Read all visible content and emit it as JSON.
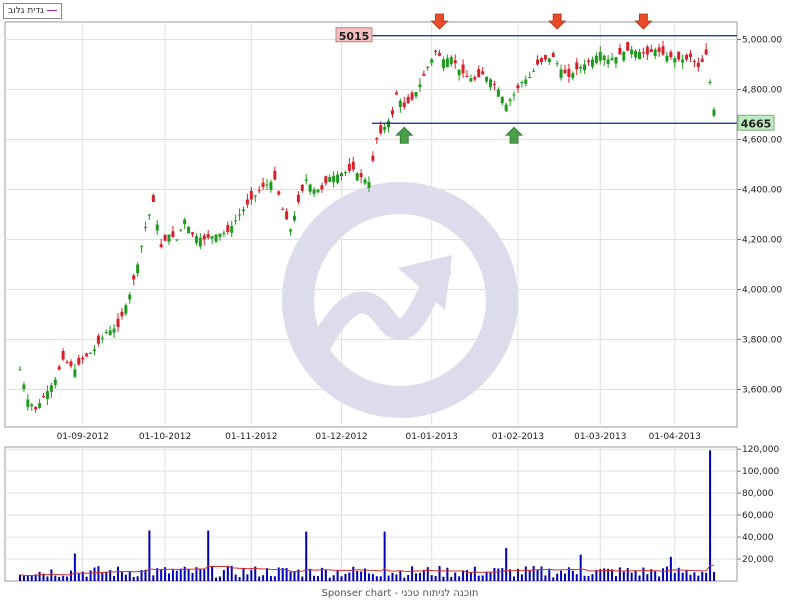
{
  "legend": {
    "label": "גדית גלוב"
  },
  "footer": {
    "text": "Sponser chart - תוכנה לניתוח טכני"
  },
  "colors": {
    "up": "#1f9a1f",
    "down": "#d8202a",
    "volume_bar": "#0000b8",
    "volume_ma": "#d03030",
    "level_line": "#0a2a8a",
    "resistance_label_bg": "#f4c0c0",
    "support_label_bg": "#bfeabf",
    "grid": "#e0e0e0",
    "arrow_down": "#e84a2a",
    "arrow_up": "#4aa04a",
    "watermark": "#dcdcec"
  },
  "chart_data": [
    {
      "type": "candlestick",
      "name": "price",
      "ylim": [
        3450,
        5070
      ],
      "y_ticks": [
        "3,600.00",
        "3,800.00",
        "4,000.00",
        "4,200.00",
        "4,400.00",
        "4,600.00",
        "4,800.00",
        "5,000.00"
      ],
      "x_tick_labels": [
        "01-09-2012",
        "01-10-2012",
        "01-11-2012",
        "01-12-2012",
        "01-01-2013",
        "01-02-2013",
        "01-03-2013",
        "01-04-2013"
      ],
      "x_tick_index": [
        16,
        37,
        59,
        82,
        105,
        127,
        148,
        167
      ],
      "candles_count": 178,
      "close_anchors": [
        [
          0,
          3680
        ],
        [
          2,
          3560
        ],
        [
          4,
          3520
        ],
        [
          6,
          3570
        ],
        [
          9,
          3640
        ],
        [
          11,
          3720
        ],
        [
          14,
          3680
        ],
        [
          16,
          3720
        ],
        [
          19,
          3760
        ],
        [
          22,
          3830
        ],
        [
          25,
          3850
        ],
        [
          28,
          3980
        ],
        [
          30,
          4100
        ],
        [
          32,
          4250
        ],
        [
          34,
          4350
        ],
        [
          36,
          4170
        ],
        [
          38,
          4220
        ],
        [
          40,
          4200
        ],
        [
          42,
          4280
        ],
        [
          44,
          4220
        ],
        [
          47,
          4200
        ],
        [
          50,
          4220
        ],
        [
          53,
          4230
        ],
        [
          56,
          4300
        ],
        [
          59,
          4360
        ],
        [
          62,
          4410
        ],
        [
          65,
          4440
        ],
        [
          67,
          4320
        ],
        [
          69,
          4240
        ],
        [
          71,
          4350
        ],
        [
          73,
          4440
        ],
        [
          75,
          4400
        ],
        [
          77,
          4400
        ],
        [
          79,
          4450
        ],
        [
          81,
          4460
        ],
        [
          83,
          4470
        ],
        [
          85,
          4480
        ],
        [
          87,
          4450
        ],
        [
          89,
          4430
        ],
        [
          91,
          4600
        ],
        [
          93,
          4650
        ],
        [
          95,
          4700
        ],
        [
          96,
          4780
        ],
        [
          98,
          4730
        ],
        [
          100,
          4760
        ],
        [
          102,
          4820
        ],
        [
          104,
          4890
        ],
        [
          106,
          4950
        ],
        [
          108,
          4920
        ],
        [
          110,
          4930
        ],
        [
          112,
          4880
        ],
        [
          114,
          4850
        ],
        [
          116,
          4840
        ],
        [
          118,
          4860
        ],
        [
          120,
          4840
        ],
        [
          122,
          4800
        ],
        [
          124,
          4740
        ],
        [
          126,
          4780
        ],
        [
          128,
          4830
        ],
        [
          130,
          4850
        ],
        [
          132,
          4900
        ],
        [
          134,
          4920
        ],
        [
          136,
          4930
        ],
        [
          138,
          4880
        ],
        [
          140,
          4850
        ],
        [
          142,
          4880
        ],
        [
          144,
          4900
        ],
        [
          146,
          4920
        ],
        [
          148,
          4950
        ],
        [
          150,
          4920
        ],
        [
          152,
          4930
        ],
        [
          154,
          4950
        ],
        [
          156,
          4960
        ],
        [
          158,
          4950
        ],
        [
          160,
          4940
        ],
        [
          162,
          4960
        ],
        [
          164,
          4940
        ],
        [
          166,
          4930
        ],
        [
          168,
          4920
        ],
        [
          170,
          4920
        ],
        [
          171,
          4930
        ],
        [
          173,
          4890
        ],
        [
          174,
          4910
        ],
        [
          175,
          4940
        ],
        [
          177,
          4720
        ]
      ],
      "resistance": {
        "value": 5015,
        "label": "5015",
        "touch_index": [
          107,
          137,
          159
        ]
      },
      "support": {
        "value": 4665,
        "label": "4665",
        "touch_index": [
          98,
          126
        ]
      }
    },
    {
      "type": "bar",
      "name": "volume",
      "ylim": [
        0,
        122000
      ],
      "y_ticks": [
        "20,000",
        "40,000",
        "60,000",
        "80,000",
        "100,000",
        "120,000"
      ],
      "spikes": [
        [
          14,
          25000
        ],
        [
          33,
          46000
        ],
        [
          48,
          46000
        ],
        [
          73,
          45000
        ],
        [
          93,
          45000
        ],
        [
          124,
          30000
        ],
        [
          143,
          24000
        ],
        [
          166,
          22000
        ],
        [
          176,
          119000
        ]
      ],
      "moving_average": true
    }
  ]
}
